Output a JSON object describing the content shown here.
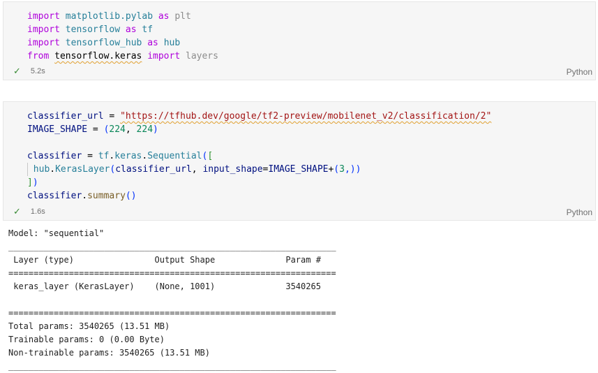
{
  "cell1": {
    "lines": [
      [
        [
          "import",
          "kw-import"
        ],
        [
          " "
        ],
        [
          "matplotlib.pylab",
          "mod"
        ],
        [
          " "
        ],
        [
          "as",
          "kw-import"
        ],
        [
          " "
        ],
        [
          "plt",
          "unused"
        ]
      ],
      [
        [
          "import",
          "kw-import"
        ],
        [
          " "
        ],
        [
          "tensorflow",
          "mod"
        ],
        [
          " "
        ],
        [
          "as",
          "kw-import"
        ],
        [
          " "
        ],
        [
          "tf",
          "mod"
        ]
      ],
      [
        [
          "import",
          "kw-import"
        ],
        [
          " "
        ],
        [
          "tensorflow_hub",
          "mod"
        ],
        [
          " "
        ],
        [
          "as",
          "kw-import"
        ],
        [
          " "
        ],
        [
          "hub",
          "mod"
        ]
      ],
      [
        [
          "from",
          "kw-import"
        ],
        [
          " "
        ],
        [
          "tensorflow.keras",
          "squiggle"
        ],
        [
          " "
        ],
        [
          "import",
          "kw-import"
        ],
        [
          " "
        ],
        [
          "layers",
          "unused"
        ]
      ]
    ],
    "status": {
      "time": "5.2s",
      "language": "Python"
    }
  },
  "cell2": {
    "lines": [
      [
        [
          "classifier_url",
          "id"
        ],
        [
          " = "
        ],
        [
          "\"https://tfhub.dev/google/tf2-preview/mobilenet_v2/classification/2\"",
          "str squiggle"
        ]
      ],
      [
        [
          "IMAGE_SHAPE",
          "id"
        ],
        [
          " = "
        ],
        [
          "(",
          "br1"
        ],
        [
          "224",
          "num"
        ],
        [
          ", "
        ],
        [
          "224",
          "num"
        ],
        [
          ")",
          "br1"
        ]
      ],
      [],
      [
        [
          "classifier",
          "id"
        ],
        [
          " = "
        ],
        [
          "tf",
          "mod"
        ],
        [
          "."
        ],
        [
          "keras",
          "mod"
        ],
        [
          "."
        ],
        [
          "Sequential",
          "mod"
        ],
        [
          "(",
          "br1"
        ],
        [
          "[",
          "br2"
        ]
      ],
      [
        [
          "",
          "guide"
        ],
        [
          "hub",
          "mod"
        ],
        [
          "."
        ],
        [
          "KerasLayer",
          "mod"
        ],
        [
          "(",
          "br1"
        ],
        [
          "classifier_url",
          "id"
        ],
        [
          ", "
        ],
        [
          "input_shape",
          "id"
        ],
        [
          "="
        ],
        [
          "IMAGE_SHAPE",
          "id"
        ],
        [
          "+"
        ],
        [
          "(",
          "br1"
        ],
        [
          "3",
          "num"
        ],
        [
          ",)",
          "br1"
        ],
        [
          ")",
          "br1"
        ]
      ],
      [
        [
          "]",
          "br2"
        ],
        [
          ")",
          "br1"
        ]
      ],
      [
        [
          "classifier",
          "id"
        ],
        [
          "."
        ],
        [
          "summary",
          "fn"
        ],
        [
          "()",
          "br1"
        ]
      ]
    ],
    "status": {
      "time": "1.6s",
      "language": "Python"
    }
  },
  "output": {
    "lines": [
      "Model: \"sequential\"",
      "_________________________________________________________________",
      " Layer (type)                Output Shape              Param #   ",
      "=================================================================",
      " keras_layer (KerasLayer)    (None, 1001)              3540265   ",
      "                                                                 ",
      "=================================================================",
      "Total params: 3540265 (13.51 MB)",
      "Trainable params: 0 (0.00 Byte)",
      "Non-trainable params: 3540265 (13.51 MB)",
      "_________________________________________________________________"
    ]
  }
}
